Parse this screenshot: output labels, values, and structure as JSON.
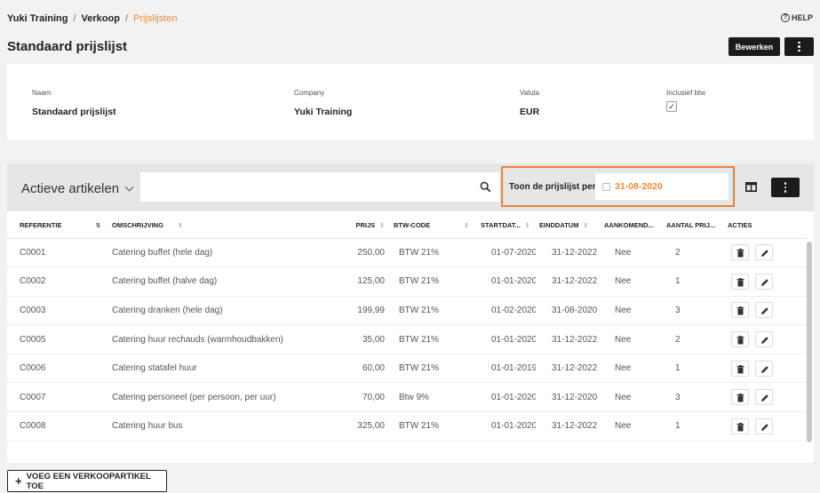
{
  "breadcrumb": {
    "items": [
      "Yuki Training",
      "Verkoop",
      "Prijslijsten"
    ]
  },
  "help_label": "HELP",
  "page": {
    "title": "Standaard prijslijst",
    "edit_label": "Bewerken"
  },
  "details": {
    "name_label": "Naam",
    "name_value": "Standaard prijslijst",
    "company_label": "Company",
    "company_value": "Yuki Training",
    "currency_label": "Valuta",
    "currency_value": "EUR",
    "vat_label": "Inclusief btw",
    "vat_checked": true
  },
  "list": {
    "title": "Actieve artikelen",
    "search_value": "",
    "date_label": "Toon de prijslijst per",
    "date_value": "31-08-2020"
  },
  "table": {
    "columns": [
      "REFERENTIE",
      "OMSCHRIJVING",
      "PRIJS",
      "BTW-CODE",
      "STARTDAT...",
      "EINDDATUM",
      "AANKOMEND...",
      "AANTAL PRIJ...",
      "ACTIES"
    ],
    "rows": [
      {
        "ref": "C0001",
        "desc": "Catering buffet (hele dag)",
        "price": "250,00",
        "vat": "BTW 21%",
        "start": "01-07-2020",
        "end": "31-12-2022",
        "upcoming": "Nee",
        "count": "2"
      },
      {
        "ref": "C0002",
        "desc": "Catering buffet (halve dag)",
        "price": "125,00",
        "vat": "BTW 21%",
        "start": "01-01-2020",
        "end": "31-12-2022",
        "upcoming": "Nee",
        "count": "1"
      },
      {
        "ref": "C0003",
        "desc": "Catering dranken (hele dag)",
        "price": "199,99",
        "vat": "BTW 21%",
        "start": "01-02-2020",
        "end": "31-08-2020",
        "upcoming": "Nee",
        "count": "3"
      },
      {
        "ref": "C0005",
        "desc": "Catering huur rechauds (warmhoudbakken)",
        "price": "35,00",
        "vat": "BTW 21%",
        "start": "01-01-2020",
        "end": "31-12-2022",
        "upcoming": "Nee",
        "count": "2"
      },
      {
        "ref": "C0006",
        "desc": "Catering statafel huur",
        "price": "60,00",
        "vat": "BTW 21%",
        "start": "01-01-2019",
        "end": "31-12-2022",
        "upcoming": "Nee",
        "count": "1"
      },
      {
        "ref": "C0007",
        "desc": "Catering personeel (per persoon, per uur)",
        "price": "70,00",
        "vat": "Btw 9%",
        "start": "01-01-2020",
        "end": "31-12-2020",
        "upcoming": "Nee",
        "count": "3"
      },
      {
        "ref": "C0008",
        "desc": "Catering huur bus",
        "price": "325,00",
        "vat": "BTW 21%",
        "start": "01-01-2020",
        "end": "31-12-2022",
        "upcoming": "Nee",
        "count": "1"
      }
    ]
  },
  "add_button_label": "VOEG EEN VERKOOPARTIKEL TOE",
  "colors": {
    "accent": "#f08a3a",
    "highlight_border": "#e8823a",
    "dark_button": "#1b1b1b"
  }
}
